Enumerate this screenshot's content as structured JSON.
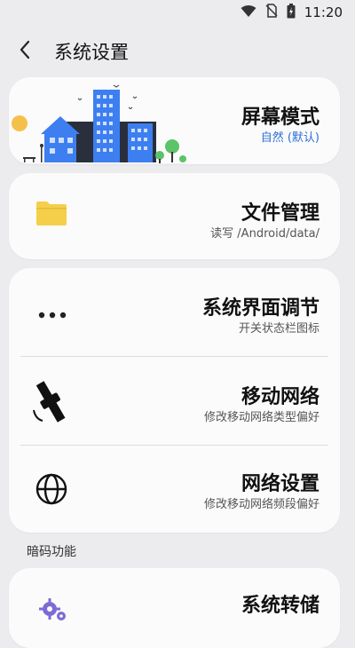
{
  "status_bar": {
    "time": "11:20",
    "icons": [
      "wifi-icon",
      "no-sim-icon",
      "battery-charging-icon"
    ]
  },
  "header": {
    "title": "系统设置",
    "back_icon": "chevron-left-icon"
  },
  "cards": [
    {
      "rows": [
        {
          "title": "屏幕模式",
          "subtitle": "自然 (默认)",
          "icon": "city-illustration"
        }
      ]
    },
    {
      "rows": [
        {
          "title": "文件管理",
          "subtitle": "读写 /Android/data/",
          "icon": "folder-icon"
        }
      ]
    },
    {
      "rows": [
        {
          "title": "系统界面调节",
          "subtitle": "开关状态栏图标",
          "icon": "more-dots-icon"
        },
        {
          "title": "移动网络",
          "subtitle": "修改移动网络类型偏好",
          "icon": "satellite-icon"
        },
        {
          "title": "网络设置",
          "subtitle": "修改移动网络频段偏好",
          "icon": "globe-icon"
        }
      ]
    }
  ],
  "section": {
    "label": "暗码功能"
  },
  "bottom_card": {
    "rows": [
      {
        "title": "系统转储",
        "icon": "gears-icon"
      }
    ]
  },
  "colors": {
    "background": "#ececee",
    "card": "#fbfbfb",
    "accent": "#2b6fd6",
    "folder": "#f5cf4a",
    "gear": "#7b6bd6"
  }
}
